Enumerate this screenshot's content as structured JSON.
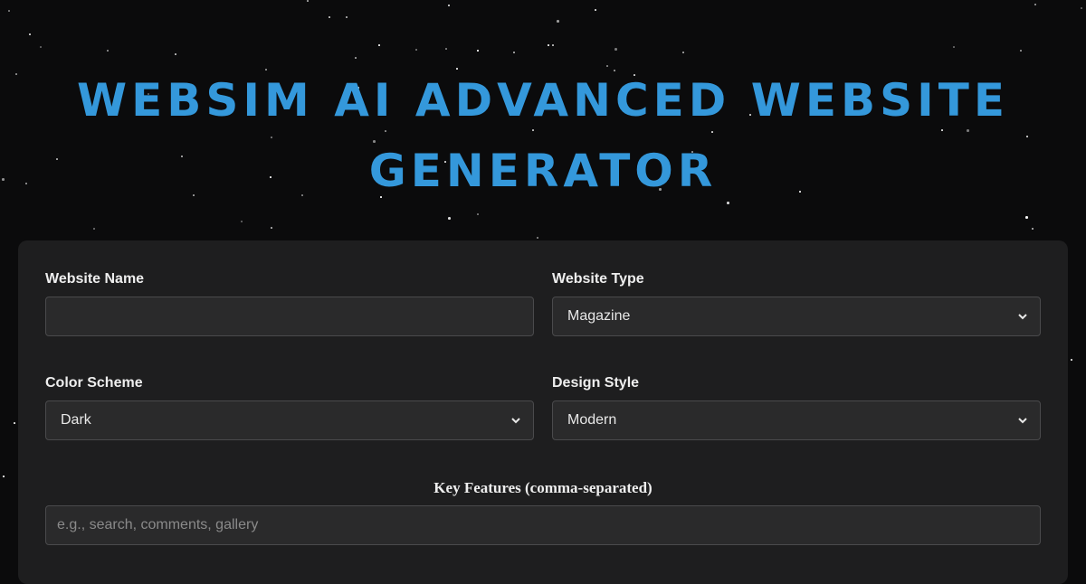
{
  "page": {
    "title": "WEBSIM AI ADVANCED WEBSITE GENERATOR",
    "accent_color": "#3498db"
  },
  "form": {
    "website_name": {
      "label": "Website Name",
      "value": ""
    },
    "website_type": {
      "label": "Website Type",
      "selected": "Magazine",
      "icon": "chevron-down-icon"
    },
    "color_scheme": {
      "label": "Color Scheme",
      "selected": "Dark",
      "icon": "chevron-down-icon"
    },
    "design_style": {
      "label": "Design Style",
      "selected": "Modern",
      "icon": "chevron-down-icon"
    },
    "key_features": {
      "label": "Key Features (comma-separated)",
      "placeholder": "e.g., search, comments, gallery",
      "value": ""
    }
  }
}
